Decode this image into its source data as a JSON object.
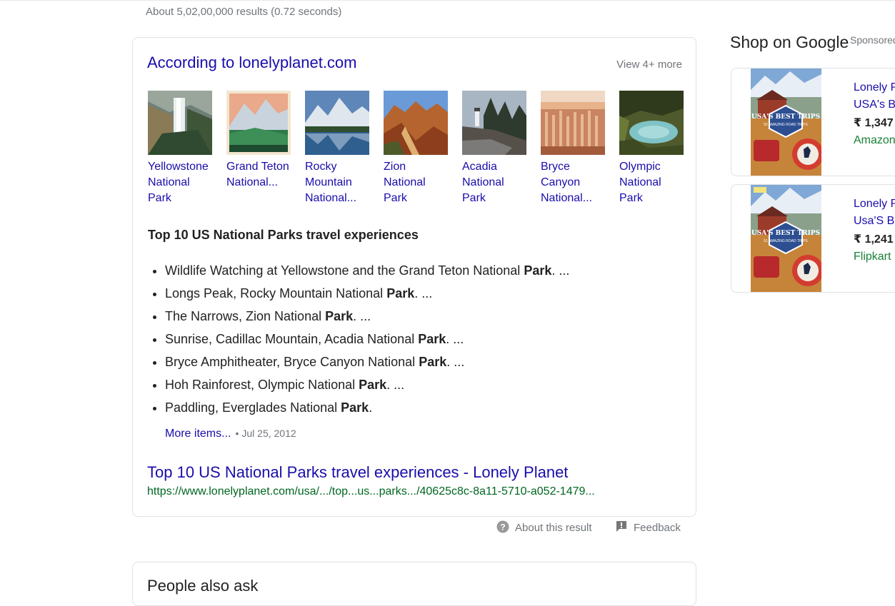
{
  "result_stats": "About 5,02,00,000 results (0.72 seconds)",
  "featured": {
    "source_title": "According to lonelyplanet.com",
    "view_more": "View 4+ more",
    "carousel": [
      {
        "lines": [
          "Yellowstone",
          "National",
          "Park"
        ]
      },
      {
        "lines": [
          "Grand Teton",
          "National..."
        ]
      },
      {
        "lines": [
          "Rocky",
          "Mountain",
          "National..."
        ]
      },
      {
        "lines": [
          "Zion",
          "National",
          "Park"
        ]
      },
      {
        "lines": [
          "Acadia",
          "National",
          "Park"
        ]
      },
      {
        "lines": [
          "Bryce",
          "Canyon",
          "National..."
        ]
      },
      {
        "lines": [
          "Olympic",
          "National",
          "Park"
        ]
      }
    ],
    "snippet_heading": "Top 10 US National Parks travel experiences",
    "list": [
      {
        "text": "Wildlife Watching at Yellowstone and the Grand Teton National ",
        "bold": "Park",
        "tail": ". ..."
      },
      {
        "text": "Longs Peak, Rocky Mountain National ",
        "bold": "Park",
        "tail": ". ..."
      },
      {
        "text": "The Narrows, Zion National ",
        "bold": "Park",
        "tail": ". ..."
      },
      {
        "text": "Sunrise, Cadillac Mountain, Acadia National ",
        "bold": "Park",
        "tail": ". ..."
      },
      {
        "text": "Bryce Amphitheater, Bryce Canyon National ",
        "bold": "Park",
        "tail": ". ..."
      },
      {
        "text": "Hoh Rainforest, Olympic National ",
        "bold": "Park",
        "tail": ". ..."
      },
      {
        "text": "Paddling, Everglades National ",
        "bold": "Park",
        "tail": "."
      }
    ],
    "more_items": "More items...",
    "date": "Jul 25, 2012",
    "result_title": "Top 10 US National Parks travel experiences - Lonely Planet",
    "result_url": "https://www.lonelyplanet.com/usa/.../top...us...parks.../40625c8c-8a11-5710-a052-1479..."
  },
  "footer": {
    "about_result": "About this result",
    "feedback": "Feedback"
  },
  "shop": {
    "heading": "Shop on Google",
    "sponsored": "Sponsored",
    "products": [
      {
        "title_line1": "Lonely Planet",
        "title_line2": "USA's Best Trips",
        "price": "₹ 1,347",
        "seller": "Amazon",
        "cover_title": "USA'S BEST TRIPS",
        "cover_sub": "52 AMAZING ROAD TRIPS"
      },
      {
        "title_line1": "Lonely Planet",
        "title_line2": "Usa'S Best Trips",
        "price": "₹ 1,241",
        "seller": "Flipkart",
        "cover_title": "USA'S BEST TRIPS",
        "cover_sub": "51 AMAZING ROAD TRIPS"
      }
    ]
  },
  "next_card_title": "People also ask",
  "colors": {
    "link": "#1a0dab",
    "url_green": "#006621",
    "seller_green": "#188038",
    "muted": "#70757a",
    "border": "#dfe1e5"
  }
}
